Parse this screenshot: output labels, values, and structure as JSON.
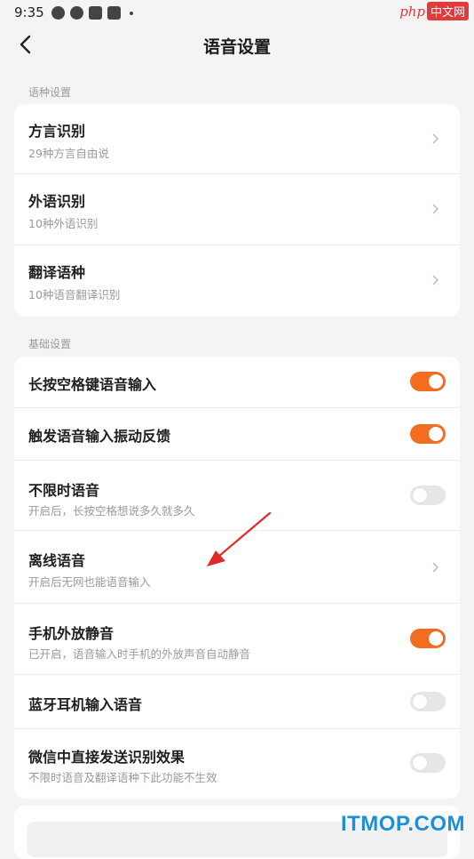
{
  "status_bar": {
    "time": "9:35",
    "icons": [
      "weibo-icon",
      "app-icon",
      "app-icon",
      "app-icon",
      "dot-icon"
    ]
  },
  "watermark_top": {
    "php": "php",
    "cn": "中文网"
  },
  "nav": {
    "back_icon": "chevron-left-icon",
    "title": "语音设置"
  },
  "language_section": {
    "label": "语种设置",
    "items": [
      {
        "title": "方言识别",
        "subtitle": "29种方言自由说"
      },
      {
        "title": "外语识别",
        "subtitle": "10种外语识别"
      },
      {
        "title": "翻译语种",
        "subtitle": "10种语音翻译识别"
      }
    ]
  },
  "basic_section": {
    "label": "基础设置",
    "items": [
      {
        "title": "长按空格键语音输入",
        "subtitle": "",
        "control": "toggle",
        "on": true
      },
      {
        "title": "触发语音输入振动反馈",
        "subtitle": "",
        "control": "toggle",
        "on": true
      },
      {
        "title": "不限时语音",
        "subtitle": "开启后，长按空格想说多久就多久",
        "control": "toggle",
        "on": false
      },
      {
        "title": "离线语音",
        "subtitle": "开启后无网也能语音输入",
        "control": "chevron"
      },
      {
        "title": "手机外放静音",
        "subtitle": "已开启，语音输入时手机的外放声音自动静音",
        "control": "toggle",
        "on": true
      },
      {
        "title": "蓝牙耳机输入语音",
        "subtitle": "",
        "control": "toggle",
        "on": false
      },
      {
        "title": "微信中直接发送识别效果",
        "subtitle": "不限时语音及翻译语种下此功能不生效",
        "control": "toggle",
        "on": false
      }
    ]
  },
  "colors": {
    "accent": "#f46c1f",
    "toggle_off": "#e6e6e6",
    "annotation_arrow": "#e02a2a"
  },
  "watermark_bottom": "ITMOP.COM"
}
